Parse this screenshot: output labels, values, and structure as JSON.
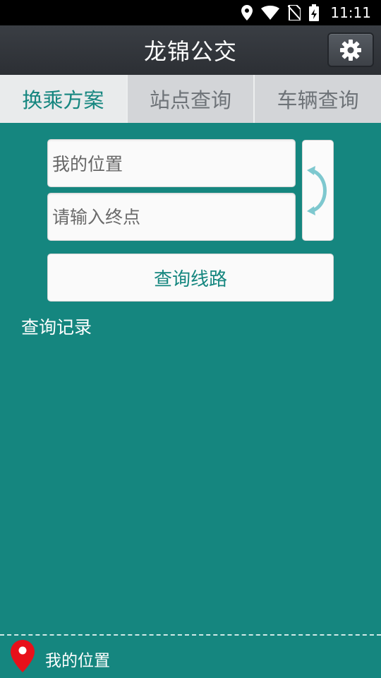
{
  "status_bar": {
    "time": "11:11",
    "icons": [
      "location-icon",
      "wifi-icon",
      "no-sim-icon",
      "battery-charging-icon"
    ]
  },
  "app_bar": {
    "title": "龙锦公交",
    "settings_icon": "gear-icon"
  },
  "tabs": [
    {
      "label": "换乘方案",
      "active": true
    },
    {
      "label": "站点查询",
      "active": false
    },
    {
      "label": "车辆查询",
      "active": false
    }
  ],
  "route_form": {
    "start_value": "我的位置",
    "end_placeholder": "请输入终点",
    "swap_icon": "swap-arrows-icon",
    "query_label": "查询线路"
  },
  "history": {
    "title": "查询记录"
  },
  "bottom_bar": {
    "location_label": "我的位置",
    "pin_icon": "map-pin-icon"
  },
  "colors": {
    "background": "#15867f",
    "accent": "#15867f",
    "app_bar": "#2c2f34",
    "pin_red": "#e8101a",
    "swap_arrow": "#7ec8cf"
  }
}
